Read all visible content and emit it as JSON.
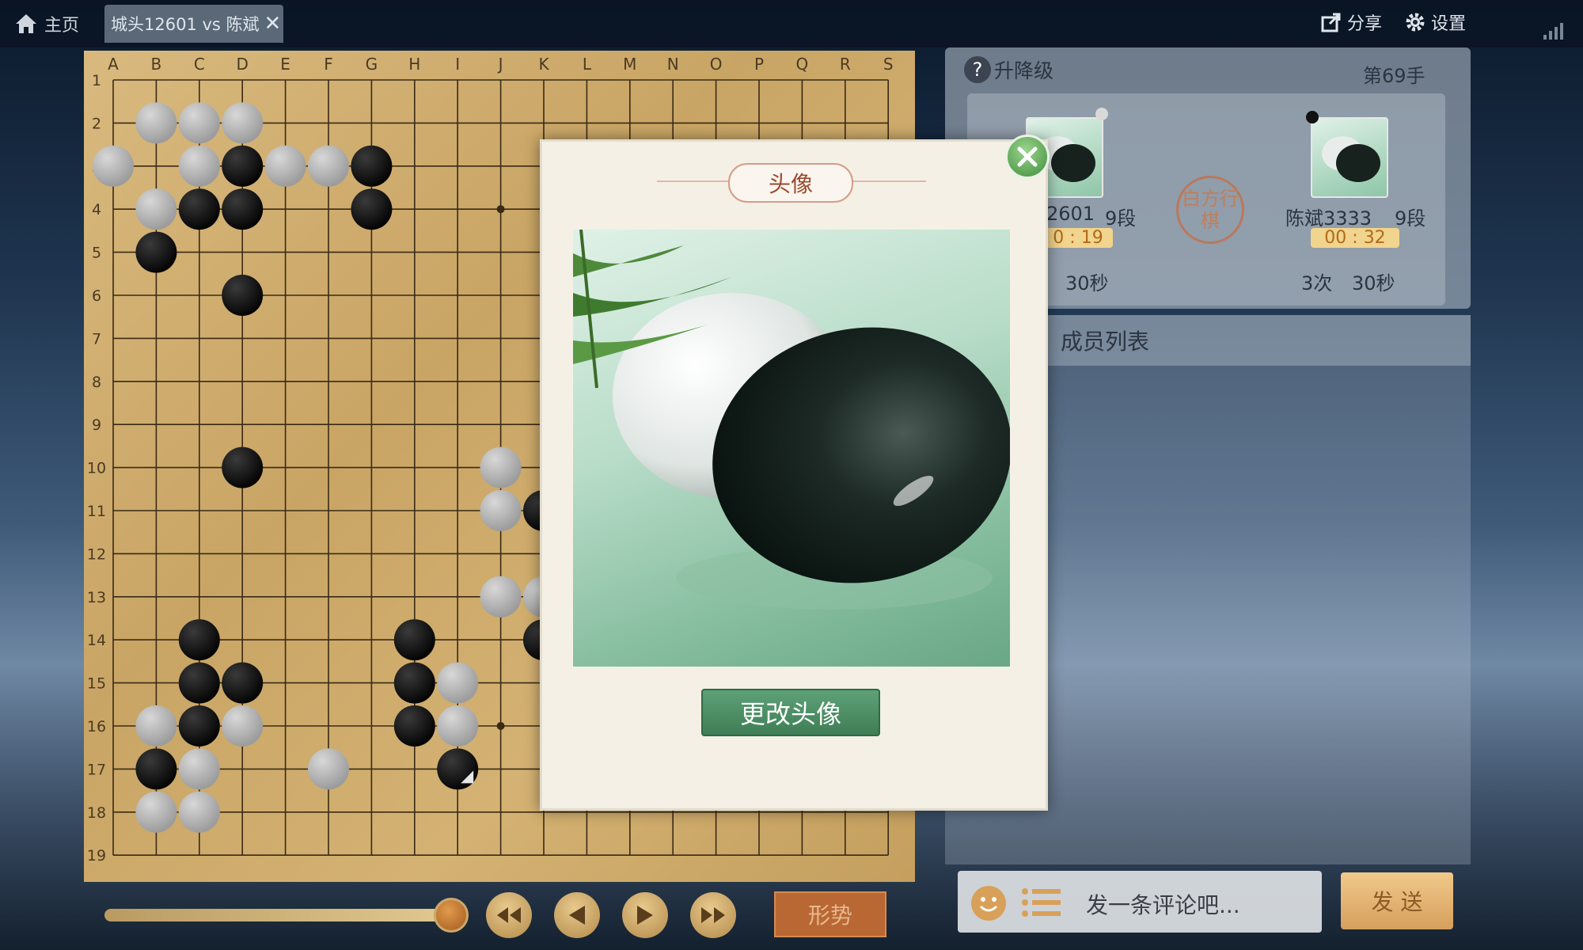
{
  "topbar": {
    "home_label": "主页",
    "tab_title": "城头12601 vs 陈斌",
    "tab_close": "✕",
    "share_label": "分享",
    "settings_label": "设置"
  },
  "board": {
    "col_labels": [
      "A",
      "B",
      "C",
      "D",
      "E",
      "F",
      "G",
      "H",
      "I",
      "J",
      "K",
      "L",
      "M",
      "N",
      "O",
      "P",
      "Q",
      "R",
      "S"
    ],
    "row_labels": [
      "1",
      "2",
      "3",
      "4",
      "5",
      "6",
      "7",
      "8",
      "9",
      "10",
      "11",
      "12",
      "13",
      "14",
      "15",
      "16",
      "17",
      "18",
      "19"
    ],
    "stones": [
      {
        "c": "B",
        "r": 2,
        "color": "white"
      },
      {
        "c": "C",
        "r": 2,
        "color": "white"
      },
      {
        "c": "D",
        "r": 2,
        "color": "white"
      },
      {
        "c": "A",
        "r": 3,
        "color": "white"
      },
      {
        "c": "C",
        "r": 3,
        "color": "white"
      },
      {
        "c": "D",
        "r": 3,
        "color": "black"
      },
      {
        "c": "E",
        "r": 3,
        "color": "white"
      },
      {
        "c": "F",
        "r": 3,
        "color": "white"
      },
      {
        "c": "G",
        "r": 3,
        "color": "black"
      },
      {
        "c": "B",
        "r": 4,
        "color": "white"
      },
      {
        "c": "C",
        "r": 4,
        "color": "black"
      },
      {
        "c": "D",
        "r": 4,
        "color": "black"
      },
      {
        "c": "G",
        "r": 4,
        "color": "black"
      },
      {
        "c": "B",
        "r": 5,
        "color": "black"
      },
      {
        "c": "D",
        "r": 6,
        "color": "black"
      },
      {
        "c": "D",
        "r": 10,
        "color": "black"
      },
      {
        "c": "J",
        "r": 10,
        "color": "white"
      },
      {
        "c": "J",
        "r": 11,
        "color": "white"
      },
      {
        "c": "K",
        "r": 11,
        "color": "black"
      },
      {
        "c": "J",
        "r": 13,
        "color": "white"
      },
      {
        "c": "K",
        "r": 13,
        "color": "white"
      },
      {
        "c": "C",
        "r": 14,
        "color": "black"
      },
      {
        "c": "H",
        "r": 14,
        "color": "black"
      },
      {
        "c": "K",
        "r": 14,
        "color": "black"
      },
      {
        "c": "C",
        "r": 15,
        "color": "black"
      },
      {
        "c": "D",
        "r": 15,
        "color": "black"
      },
      {
        "c": "H",
        "r": 15,
        "color": "black"
      },
      {
        "c": "I",
        "r": 15,
        "color": "white"
      },
      {
        "c": "B",
        "r": 16,
        "color": "white"
      },
      {
        "c": "C",
        "r": 16,
        "color": "black"
      },
      {
        "c": "D",
        "r": 16,
        "color": "white"
      },
      {
        "c": "H",
        "r": 16,
        "color": "black"
      },
      {
        "c": "I",
        "r": 16,
        "color": "white"
      },
      {
        "c": "B",
        "r": 17,
        "color": "black"
      },
      {
        "c": "C",
        "r": 17,
        "color": "white"
      },
      {
        "c": "F",
        "r": 17,
        "color": "white"
      },
      {
        "c": "I",
        "r": 17,
        "color": "black",
        "last": true
      },
      {
        "c": "B",
        "r": 18,
        "color": "white"
      },
      {
        "c": "C",
        "r": 18,
        "color": "white"
      }
    ],
    "star_points": [
      {
        "c": "J",
        "r": 4
      },
      {
        "c": "J",
        "r": 16
      }
    ]
  },
  "controls": {
    "xingshi_label": "形势",
    "progress": 1.0
  },
  "right_panel": {
    "title": "升降级",
    "move_number": "第69手",
    "player1": {
      "name": "2601",
      "rank": "9段",
      "time": "0 : 19",
      "byoyomi": "30秒"
    },
    "player2": {
      "name": "陈斌3333",
      "rank": "9段",
      "time": "00 : 32",
      "periods": "3次",
      "byoyomi": "30秒"
    },
    "turn_seal": "白方行棋",
    "members_label": "成员列表",
    "comment_placeholder": "发一条评论吧...",
    "send_label": "发 送"
  },
  "dialog": {
    "title": "头像",
    "change_button": "更改头像"
  },
  "colors": {
    "accent_green": "#3f7e56",
    "board_wood": "#c9a565",
    "send_button": "#d69f5c"
  }
}
